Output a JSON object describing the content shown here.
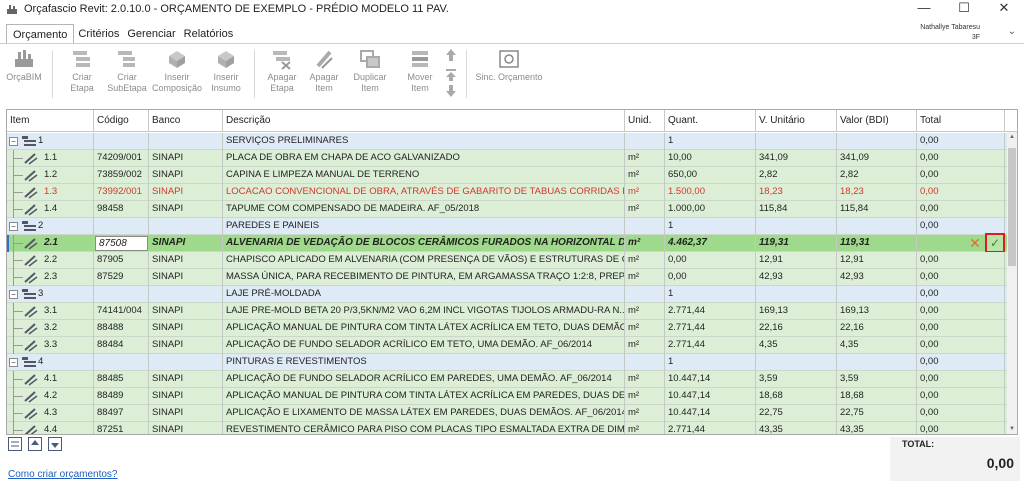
{
  "window": {
    "title": "Orçafascio Revit: 2.0.10.0 - ORÇAMENTO DE EXEMPLO - PRÉDIO MODELO 11 PAV.",
    "controls": {
      "minimize": "—",
      "maximize": "☐",
      "close": "✕"
    }
  },
  "menu": {
    "tabs": [
      {
        "label": "Orçamento",
        "active": true
      },
      {
        "label": "Critérios"
      },
      {
        "label": "Gerenciar"
      },
      {
        "label": "Relatórios"
      }
    ]
  },
  "user": {
    "name": "Nathallye Tabaresu",
    "sub": "3F"
  },
  "toolbar": {
    "buttons": [
      {
        "label1": "OrçaBIM",
        "label2": "",
        "icon": "orcabim-icon"
      },
      {
        "label1": "Criar",
        "label2": "Etapa",
        "icon": "create-stage-icon"
      },
      {
        "label1": "Criar",
        "label2": "SubEtapa",
        "icon": "create-substage-icon"
      },
      {
        "label1": "Inserir",
        "label2": "Composição",
        "icon": "insert-composition-icon"
      },
      {
        "label1": "Inserir",
        "label2": "Insumo",
        "icon": "insert-input-icon"
      },
      {
        "label1": "Apagar",
        "label2": "Etapa",
        "icon": "delete-stage-icon"
      },
      {
        "label1": "Apagar",
        "label2": "Item",
        "icon": "delete-item-icon"
      },
      {
        "label1": "Duplicar",
        "label2": "Item",
        "icon": "duplicate-item-icon"
      },
      {
        "label1": "Mover",
        "label2": "Item",
        "icon": "move-item-icon"
      },
      {
        "label1": "Sinc. Orçamento",
        "label2": "",
        "icon": "sync-budget-icon"
      }
    ]
  },
  "grid": {
    "columns": [
      "Item",
      "Código",
      "Banco",
      "Descrição",
      "Unid.",
      "Quant.",
      "V. Unitário",
      "Valor (BDI)",
      "Total"
    ],
    "rows": [
      {
        "type": "stage",
        "item": "1",
        "code": "",
        "bank": "",
        "desc": "SERVIÇOS PRELIMINARES",
        "unit": "",
        "qty": "1",
        "unitValue": "",
        "bdi": "",
        "total": "0,00"
      },
      {
        "type": "item",
        "item": "1.1",
        "code": "74209/001",
        "bank": "SINAPI",
        "desc": "PLACA DE OBRA EM CHAPA DE ACO GALVANIZADO",
        "unit": "m²",
        "qty": "10,00",
        "unitValue": "341,09",
        "bdi": "341,09",
        "total": "0,00"
      },
      {
        "type": "item",
        "item": "1.2",
        "code": "73859/002",
        "bank": "SINAPI",
        "desc": "CAPINA E LIMPEZA MANUAL DE TERRENO",
        "unit": "m²",
        "qty": "650,00",
        "unitValue": "2,82",
        "bdi": "2,82",
        "total": "0,00"
      },
      {
        "type": "item-red",
        "item": "1.3",
        "code": "73992/001",
        "bank": "SINAPI",
        "desc": "LOCACAO CONVENCIONAL DE OBRA, ATRAVÉS DE GABARITO DE TABUAS CORRIDAS P...",
        "unit": "m²",
        "qty": "1.500,00",
        "unitValue": "18,23",
        "bdi": "18,23",
        "total": "0,00"
      },
      {
        "type": "item",
        "item": "1.4",
        "code": "98458",
        "bank": "SINAPI",
        "desc": "TAPUME COM COMPENSADO DE MADEIRA. AF_05/2018",
        "unit": "m²",
        "qty": "1.000,00",
        "unitValue": "115,84",
        "bdi": "115,84",
        "total": "0,00"
      },
      {
        "type": "stage",
        "item": "2",
        "code": "",
        "bank": "",
        "desc": "PAREDES E PAINEIS",
        "unit": "",
        "qty": "1",
        "unitValue": "",
        "bdi": "",
        "total": "0,00"
      },
      {
        "type": "selected",
        "item": "2.1",
        "code": "87508",
        "bank": "SINAPI",
        "desc": "ALVENARIA DE VEDAÇÃO DE BLOCOS CERÂMICOS FURADOS NA HORIZONTAL DE 9...",
        "unit": "m²",
        "qty": "4.462,37",
        "unitValue": "119,31",
        "bdi": "119,31",
        "total": ""
      },
      {
        "type": "item",
        "item": "2.2",
        "code": "87905",
        "bank": "SINAPI",
        "desc": "CHAPISCO APLICADO EM ALVENARIA (COM PRESENÇA DE VÃOS) E ESTRUTURAS DE CO...",
        "unit": "m²",
        "qty": "0,00",
        "unitValue": "12,91",
        "bdi": "12,91",
        "total": "0,00"
      },
      {
        "type": "item",
        "item": "2.3",
        "code": "87529",
        "bank": "SINAPI",
        "desc": "MASSA ÚNICA, PARA RECEBIMENTO DE PINTURA, EM ARGAMASSA TRAÇO 1:2:8, PREPA...",
        "unit": "m²",
        "qty": "0,00",
        "unitValue": "42,93",
        "bdi": "42,93",
        "total": "0,00"
      },
      {
        "type": "stage",
        "item": "3",
        "code": "",
        "bank": "",
        "desc": "LAJE PRÉ-MOLDADA",
        "unit": "",
        "qty": "1",
        "unitValue": "",
        "bdi": "",
        "total": "0,00"
      },
      {
        "type": "item",
        "item": "3.1",
        "code": "74141/004",
        "bank": "SINAPI",
        "desc": "LAJE PRE-MOLD BETA 20 P/3,5KN/M2 VAO 6,2M INCL VIGOTAS TIJOLOS ARMADU-RA N...",
        "unit": "m²",
        "qty": "2.771,44",
        "unitValue": "169,13",
        "bdi": "169,13",
        "total": "0,00"
      },
      {
        "type": "item",
        "item": "3.2",
        "code": "88488",
        "bank": "SINAPI",
        "desc": "APLICAÇÃO MANUAL DE PINTURA COM TINTA LÁTEX ACRÍLICA EM TETO, DUAS DEMÃO...",
        "unit": "m²",
        "qty": "2.771,44",
        "unitValue": "22,16",
        "bdi": "22,16",
        "total": "0,00"
      },
      {
        "type": "item",
        "item": "3.3",
        "code": "88484",
        "bank": "SINAPI",
        "desc": "APLICAÇÃO DE FUNDO SELADOR ACRÍLICO EM TETO, UMA DEMÃO. AF_06/2014",
        "unit": "m²",
        "qty": "2.771,44",
        "unitValue": "4,35",
        "bdi": "4,35",
        "total": "0,00"
      },
      {
        "type": "stage",
        "item": "4",
        "code": "",
        "bank": "",
        "desc": "PINTURAS E REVESTIMENTOS",
        "unit": "",
        "qty": "1",
        "unitValue": "",
        "bdi": "",
        "total": "0,00"
      },
      {
        "type": "item",
        "item": "4.1",
        "code": "88485",
        "bank": "SINAPI",
        "desc": "APLICAÇÃO DE FUNDO SELADOR ACRÍLICO EM PAREDES, UMA DEMÃO. AF_06/2014",
        "unit": "m²",
        "qty": "10.447,14",
        "unitValue": "3,59",
        "bdi": "3,59",
        "total": "0,00"
      },
      {
        "type": "item",
        "item": "4.2",
        "code": "88489",
        "bank": "SINAPI",
        "desc": "APLICAÇÃO MANUAL DE PINTURA COM TINTA LÁTEX ACRÍLICA EM PAREDES, DUAS DE...",
        "unit": "m²",
        "qty": "10.447,14",
        "unitValue": "18,68",
        "bdi": "18,68",
        "total": "0,00"
      },
      {
        "type": "item",
        "item": "4.3",
        "code": "88497",
        "bank": "SINAPI",
        "desc": "APLICAÇÃO E LIXAMENTO DE MASSA LÁTEX EM PAREDES, DUAS DEMÃOS. AF_06/2014",
        "unit": "m²",
        "qty": "10.447,14",
        "unitValue": "22,75",
        "bdi": "22,75",
        "total": "0,00"
      },
      {
        "type": "item",
        "item": "4.4",
        "code": "87251",
        "bank": "SINAPI",
        "desc": "REVESTIMENTO CERÂMICO PARA PISO COM PLACAS TIPO ESMALTADA EXTRA DE DIME...",
        "unit": "m²",
        "qty": "2.771,44",
        "unitValue": "43,35",
        "bdi": "43,35",
        "total": "0,00"
      }
    ]
  },
  "footer": {
    "total_label": "TOTAL:",
    "total_value": "0,00",
    "help_link": "Como criar orçamentos?"
  },
  "colors": {
    "stage_row": "#dfeaf7",
    "item_row": "#dcefd6",
    "selected_row": "#9fd98b",
    "red_text": "#d1372b",
    "link": "#1f5fbf",
    "confirm_highlight": "#d92020"
  }
}
